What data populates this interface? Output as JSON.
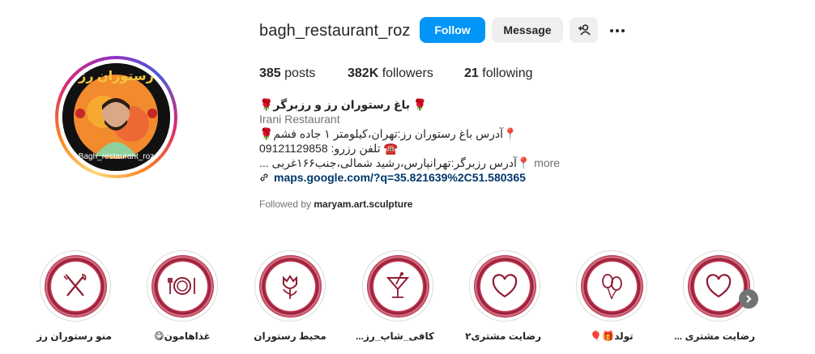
{
  "profile": {
    "username": "bagh_restaurant_roz",
    "follow_label": "Follow",
    "message_label": "Message",
    "avatar_title": "رستوران رز",
    "avatar_handle": "Bagh_restaurant_roz"
  },
  "stats": {
    "posts_count": "385",
    "posts_label": "posts",
    "followers_count": "382K",
    "followers_label": "followers",
    "following_count": "21",
    "following_label": "following"
  },
  "bio": {
    "name": "🌹 باغ رستوران رز و رزبرگر🌹",
    "category": "Irani Restaurant",
    "line1": "📍آدرس باغ رستوران رز:تهران،کیلومتر ۱ جاده فشم🌹",
    "line2": "☎️ تلفن رزرو: 09121129858",
    "line3": "📍آدرس رزبرگر:تهرانپارس،رشید شمالی،جنب۱۶۶غربی ...",
    "more": "more",
    "link": "maps.google.com/?q=35.821639%2C51.580365"
  },
  "followed_by": {
    "prefix": "Followed by",
    "user": "maryam.art.sculpture"
  },
  "highlights": [
    {
      "label": "منو رستوران رز",
      "icon": "fork-knife-icon"
    },
    {
      "label": "غذاهامون😋",
      "icon": "plate-icon"
    },
    {
      "label": "محیط رستوران",
      "icon": "tulip-icon"
    },
    {
      "label": "کافی_شاپ_رز...",
      "icon": "cocktail-icon"
    },
    {
      "label": "رضایت مشتری۲",
      "icon": "heart-icon"
    },
    {
      "label": "تولد🎁🎈",
      "icon": "balloons-icon"
    },
    {
      "label": "رضایت مشتری ...",
      "icon": "heart-icon"
    }
  ],
  "colors": {
    "primary_button": "#0095f6",
    "secondary_button": "#efefef",
    "link": "#00376b",
    "highlight_ring": "#a61e3c"
  }
}
